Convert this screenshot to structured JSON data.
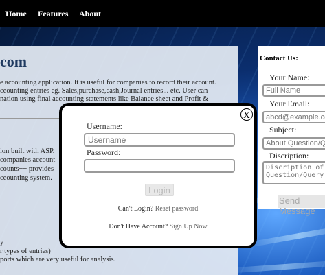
{
  "navbar": {
    "links": [
      "Home",
      "Features",
      "About"
    ]
  },
  "content": {
    "title": "com",
    "paragraph1": [
      "e accounting application. It is useful for companies to record their account.",
      "ccounting entries eg. Sales,purchase,cash,Journal entries... etc. User can",
      "nation using final accounting statements like Balance sheet and Profit &"
    ],
    "paragraph2": [
      "ion built with ASP.",
      "companies account",
      "counts++ provides",
      "ccounting system."
    ],
    "paragraph3": [
      "y",
      "r types of entries)",
      "ports which are very useful for analysis."
    ]
  },
  "contact": {
    "title": "Contact Us:",
    "name_label": "Your Name:",
    "name_placeholder": "Full Name",
    "email_label": "Your Email:",
    "email_placeholder": "abcd@example.com",
    "subject_label": "Subject:",
    "subject_placeholder": "About Question/Query",
    "description_label": "Discription:",
    "description_placeholder": "Discription of Question/Query",
    "send_label": "Send Message"
  },
  "login_modal": {
    "close_label": "X",
    "username_label": "Username:",
    "username_placeholder": "Username",
    "password_label": "Password:",
    "login_label": "Login",
    "forgot_prefix": "Can't Login?",
    "forgot_link": "Reset password",
    "signup_prefix": "Don't Have Account?",
    "signup_link": "Sign Up Now"
  }
}
